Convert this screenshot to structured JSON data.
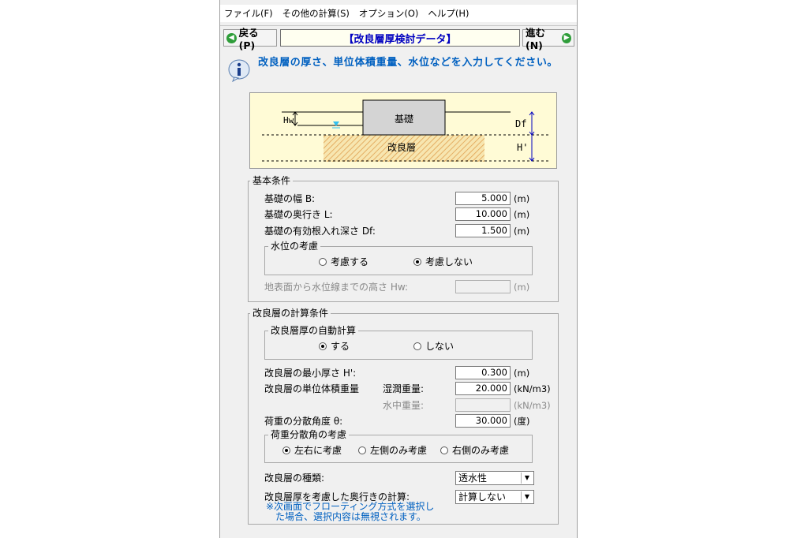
{
  "menu": [
    "ファイル(F)",
    "その他の計算(S)",
    "オプション(O)",
    "ヘルプ(H)"
  ],
  "nav": {
    "back_label": "戻る(P)",
    "title": "【改良層厚検討データ】",
    "next_label": "進む(N)"
  },
  "info": {
    "message": "改良層の厚さ、単位体積重量、水位などを入力してください。"
  },
  "diagram": {
    "foundation": "基礎",
    "improved_layer": "改良層",
    "hw": "Hw",
    "df": "Df",
    "h": "H'"
  },
  "basic": {
    "title": "基本条件",
    "width_label": "基礎の幅 B:",
    "width_value": "5.000",
    "width_unit": "(m)",
    "depth_label": "基礎の奥行き L:",
    "depth_value": "10.000",
    "depth_unit": "(m)",
    "df_label": "基礎の有効根入れ深さ Df:",
    "df_value": "1.500",
    "df_unit": "(m)",
    "water_group_title": "水位の考慮",
    "water_opt1": "考慮する",
    "water_opt2": "考慮しない",
    "hw_label": "地表面から水位線までの高さ Hw:",
    "hw_value": "",
    "hw_unit": "(m)"
  },
  "calc": {
    "title": "改良層の計算条件",
    "auto_group_title": "改良層厚の自動計算",
    "auto_opt1": "する",
    "auto_opt2": "しない",
    "min_label": "改良層の最小厚さ H':",
    "min_value": "0.300",
    "min_unit": "(m)",
    "unit_weight_label": "改良層の単位体積重量",
    "wet_label": "湿潤重量:",
    "wet_value": "20.000",
    "wet_unit": "(kN/m3)",
    "sub_label": "水中重量:",
    "sub_value": "",
    "sub_unit": "(kN/m3)",
    "angle_label": "荷重の分散角度 θ:",
    "angle_value": "30.000",
    "angle_unit": "(度)",
    "disp_group_title": "荷重分散角の考慮",
    "disp_opt1": "左右に考慮",
    "disp_opt2": "左側のみ考慮",
    "disp_opt3": "右側のみ考慮",
    "type_label": "改良層の種類:",
    "type_value": "透水性",
    "depth_calc_label": "改良層厚を考慮した奥行きの計算:",
    "depth_calc_value": "計算しない",
    "note_line1": "※次画面でフローティング方式を選択し",
    "note_line2": "た場合、選択内容は無視されます。"
  },
  "colors": {
    "accent_blue": "#0060c0",
    "title_blue": "#0000c0",
    "nav_green": "#2f9d3a",
    "diagram_bg": "#fffbd6",
    "hatch": "#e0a050"
  }
}
